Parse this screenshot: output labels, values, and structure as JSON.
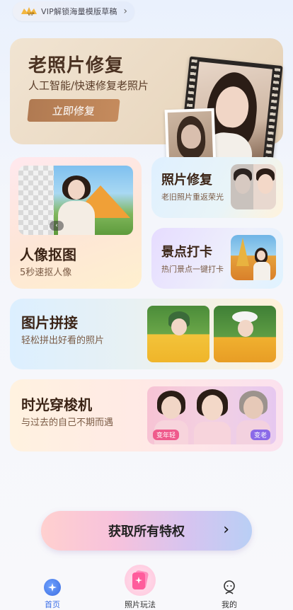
{
  "vip_banner": {
    "badge": "VIP",
    "label": "VIP解锁海量模版草稿",
    "chevron": "›"
  },
  "hero": {
    "title": "老照片修复",
    "subtitle": "人工智能/快速修复老照片",
    "button": "立即修复"
  },
  "cards": {
    "portrait_cutout": {
      "title": "人像抠图",
      "subtitle": "5秒速抠人像",
      "nav_icon": "‹"
    },
    "photo_repair": {
      "title": "照片修复",
      "subtitle": "老旧照片重返荣光"
    },
    "scenic_checkin": {
      "title": "景点打卡",
      "subtitle": "热门景点一键打卡"
    },
    "collage": {
      "title": "图片拼接",
      "subtitle": "轻松拼出好看的照片"
    },
    "time_machine": {
      "title": "时光穿梭机",
      "subtitle": "与过去的自己不期而遇",
      "badge_young": "变年轻",
      "badge_old": "变老"
    }
  },
  "privilege": {
    "label": "获取所有特权",
    "arrow": "›"
  },
  "tabbar": {
    "tabs": [
      {
        "label": "首页",
        "icon": "home-star-icon",
        "active": true
      },
      {
        "label": "照片玩法",
        "icon": "photo-play-icon",
        "active": false
      },
      {
        "label": "我的",
        "icon": "profile-icon",
        "active": false
      }
    ]
  },
  "colors": {
    "accent": "#3c6fe8",
    "hero_button": "#b07a52",
    "text_dark": "#3b2416",
    "text_sub": "#7a5b45"
  }
}
